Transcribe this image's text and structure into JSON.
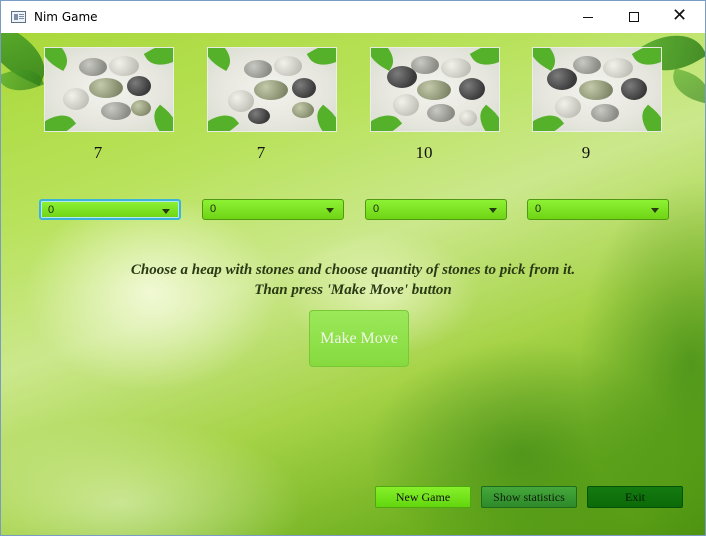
{
  "window": {
    "title": "Nim Game",
    "controls": [
      "minimize",
      "maximize",
      "close"
    ],
    "close_glyph": "✕"
  },
  "heaps": [
    {
      "count": "7",
      "selected": "0"
    },
    {
      "count": "7",
      "selected": "0"
    },
    {
      "count": "10",
      "selected": "0"
    },
    {
      "count": "9",
      "selected": "0"
    }
  ],
  "instructions": {
    "line1": "Choose a heap with stones and choose quantity of stones to pick from it.",
    "line2": "Than press 'Make Move' button"
  },
  "make_move_label": "Make Move",
  "bottom_buttons": {
    "new_game": "New Game",
    "show_statistics": "Show statistics",
    "exit": "Exit"
  },
  "colors": {
    "accent_green": "#7ee02a",
    "dark_green": "#0f700c",
    "focus_blue": "#3cb4d6"
  },
  "icons": [
    "app-window-icon",
    "dropdown-arrow-icon",
    "close-icon",
    "minimize-icon",
    "maximize-icon"
  ]
}
